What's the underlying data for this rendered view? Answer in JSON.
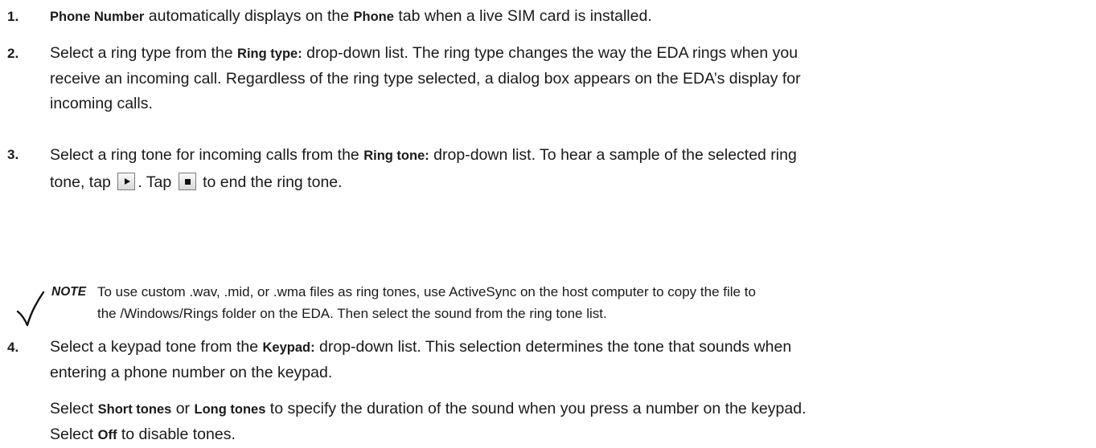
{
  "steps": [
    {
      "number": "1.",
      "parts": {
        "a": "Phone Number",
        "b": " automatically displays on the ",
        "c": "Phone",
        "d": " tab when a live SIM card is installed."
      }
    },
    {
      "number": "2.",
      "parts": {
        "a": "Select a ring type from the ",
        "b": "Ring type:",
        "c": " drop-down list. The ring type changes the way the EDA rings when you",
        "d": "receive an incoming call. Regardless of the ring type selected, a dialog box appears on the EDA’s display for",
        "e": "incoming calls."
      }
    },
    {
      "number": "3.",
      "parts": {
        "a": "Select a ring tone for incoming calls from the ",
        "b": "Ring tone:",
        "c": " drop-down list. To hear a sample of the selected ring",
        "d": "tone, tap ",
        "e": ". Tap ",
        "f": " to end the ring tone."
      }
    },
    {
      "number": "4.",
      "parts": {
        "a": "Select a keypad tone from the ",
        "b": "Keypad:",
        "c": " drop-down list. This selection determines the tone that sounds when",
        "d": "entering a phone number on the keypad.",
        "e": "Select ",
        "f": "Short tones",
        "g": " or ",
        "h": "Long tones",
        "i": " to specify the duration of the sound when you press a number on the keypad.",
        "j": "Select ",
        "k": "Off",
        "l": " to disable tones."
      }
    }
  ],
  "note": {
    "label": "NOTE",
    "line1": "To use custom .wav, .mid, or .wma files as ring tones, use ActiveSync on the host computer to copy the file to",
    "line2": "the /Windows/Rings folder on the EDA. Then select the sound from the ring tone list."
  },
  "icons": {
    "play": "play-button-icon",
    "stop": "stop-button-icon",
    "note": "checkmark-icon"
  }
}
